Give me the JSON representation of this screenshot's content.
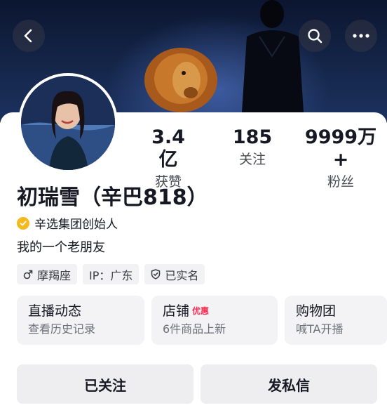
{
  "header": {
    "back_icon": "chevron-left-icon",
    "search_icon": "search-icon",
    "more_icon": "more-horizontal-icon"
  },
  "stats": [
    {
      "value": "3.4亿",
      "label": "获赞"
    },
    {
      "value": "185",
      "label": "关注"
    },
    {
      "value": "9999万+",
      "label": "粉丝"
    }
  ],
  "profile": {
    "name": "初瑞雪（辛巴818）",
    "verification": "辛选集团创始人",
    "bio": "我的一个老朋友",
    "tags": [
      {
        "icon": "male-icon",
        "text": "摩羯座"
      },
      {
        "text": "IP：广东"
      },
      {
        "icon": "shield-check-icon",
        "text": "已实名"
      }
    ]
  },
  "entries": [
    {
      "title": "直播动态",
      "subtitle": "查看历史记录"
    },
    {
      "title": "店铺",
      "badge": "优惠",
      "subtitle": "6件商品上新"
    },
    {
      "title": "购物团",
      "subtitle": "喊TA开播"
    }
  ],
  "actions": {
    "follow_label": "已关注",
    "message_label": "发私信"
  },
  "colors": {
    "accent_red": "#fe2c55",
    "verify_gold": "#f5b920",
    "banner_dark": "#0b1630"
  }
}
